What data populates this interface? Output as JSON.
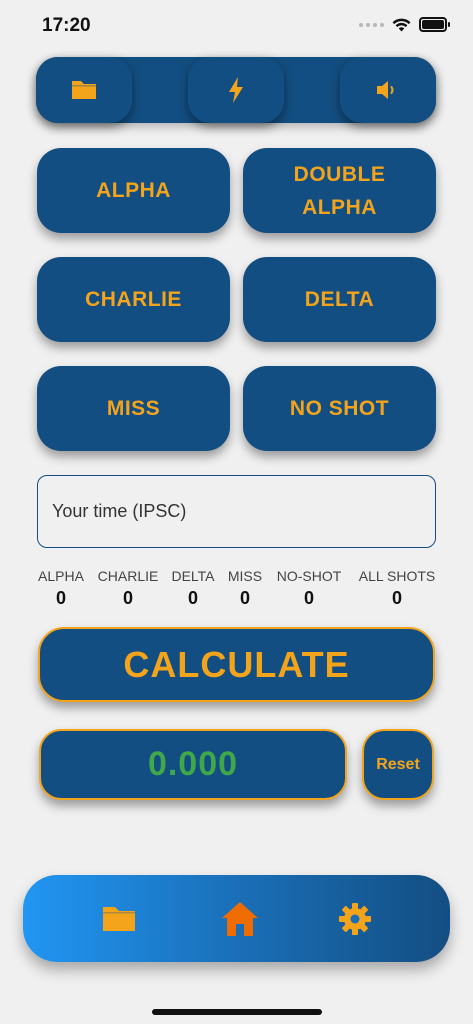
{
  "status_bar": {
    "time": "17:20"
  },
  "toolbar": {
    "buttons": [
      {
        "icon": "folder-icon",
        "color": "#f3a41b"
      },
      {
        "icon": "lightning-icon",
        "color": "#f3a41b"
      },
      {
        "icon": "speaker-icon",
        "color": "#f3a41b"
      }
    ]
  },
  "score_buttons": {
    "alpha": "ALPHA",
    "double_alpha": "DOUBLE\nALPHA",
    "charlie": "CHARLIE",
    "delta": "DELTA",
    "miss": "MISS",
    "no_shot": "NO SHOT"
  },
  "time_input": {
    "placeholder": "Your time (IPSC)",
    "value": ""
  },
  "counters": [
    {
      "label": "ALPHA",
      "value": "0"
    },
    {
      "label": "CHARLIE",
      "value": "0"
    },
    {
      "label": "DELTA",
      "value": "0"
    },
    {
      "label": "MISS",
      "value": "0"
    },
    {
      "label": "NO-SHOT",
      "value": "0"
    },
    {
      "label": "ALL SHOTS",
      "value": "0"
    }
  ],
  "calculate_label": "CALCULATE",
  "result_value": "0.000",
  "reset_label": "Reset",
  "bottom_nav": {
    "items": [
      {
        "icon": "folder-icon",
        "color": "#f3a41b"
      },
      {
        "icon": "home-icon",
        "color": "#ef6c00",
        "active": true
      },
      {
        "icon": "gear-icon",
        "color": "#f3a41b"
      }
    ]
  },
  "colors": {
    "primary": "#134e82",
    "accent": "#f3a41b",
    "result": "#3fa94a",
    "background": "#f0f0f0"
  }
}
